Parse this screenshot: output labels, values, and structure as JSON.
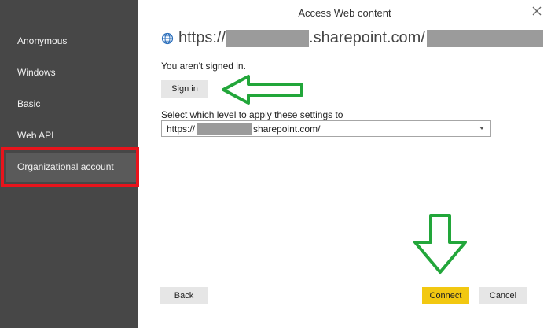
{
  "dialog": {
    "title": "Access Web content"
  },
  "sidebar": {
    "items": [
      {
        "label": "Anonymous"
      },
      {
        "label": "Windows"
      },
      {
        "label": "Basic"
      },
      {
        "label": "Web API"
      },
      {
        "label": "Organizational account",
        "selected": true
      }
    ]
  },
  "main": {
    "url_prefix": "https://",
    "url_mid": ".sharepoint.com/",
    "status": "You aren't signed in.",
    "sign_in_label": "Sign in",
    "level_label": "Select which level to apply these settings to",
    "level_value_prefix": "https://",
    "level_value_suffix": "sharepoint.com/"
  },
  "footer": {
    "back_label": "Back",
    "connect_label": "Connect",
    "cancel_label": "Cancel"
  },
  "colors": {
    "sidebar_bg": "#474747",
    "primary_button": "#f2c811",
    "highlight_red": "#e8141c",
    "annotation_green": "#22a63a"
  }
}
